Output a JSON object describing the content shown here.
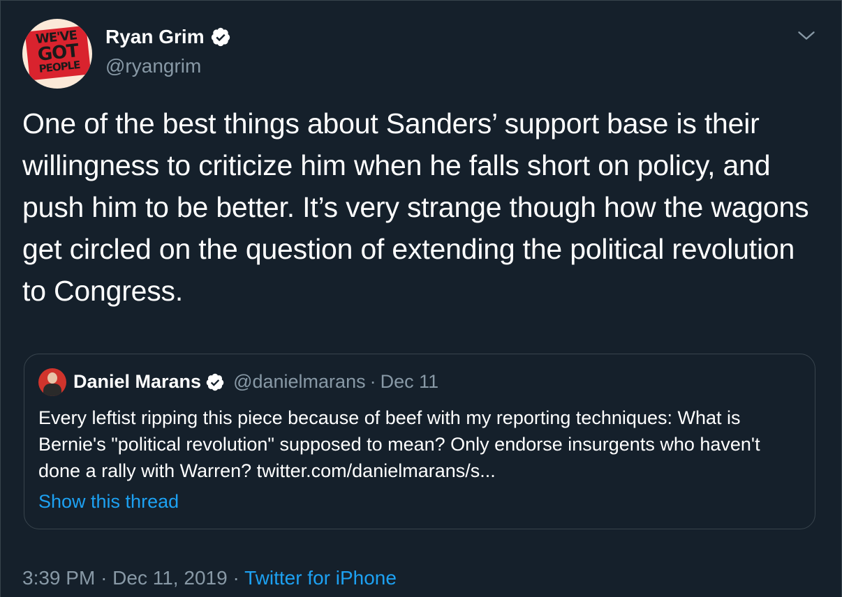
{
  "author": {
    "display_name": "Ryan Grim",
    "handle": "@ryangrim",
    "verified": true,
    "avatar_text": [
      "WE'VE",
      "GOT",
      "PEOPLE"
    ]
  },
  "tweet": {
    "text": "One of the best things about Sanders’ support base is their willingness to criticize him when he falls short on policy, and push him to be better. It’s very strange though how the wagons get circled on the question of extending the political revolution to Congress."
  },
  "quoted_tweet": {
    "display_name": "Daniel Marans",
    "handle": "@danielmarans",
    "separator": "·",
    "date": "Dec 11",
    "verified": true,
    "text": "Every leftist ripping this piece because of beef with my reporting techniques: What is Bernie's \"political revolution\" supposed to mean? Only endorse insurgents who haven't done a rally with Warren? twitter.com/danielmarans/s...",
    "show_thread_label": "Show this thread"
  },
  "meta": {
    "time": "3:39 PM",
    "separator": "·",
    "date": "Dec 11, 2019",
    "source": "Twitter for iPhone"
  },
  "colors": {
    "background": "#15202b",
    "border": "#38444d",
    "secondary_text": "#8899a6",
    "link": "#1da1f2",
    "verified_badge": "#ffffff"
  },
  "icons": {
    "verified": "verified-badge-icon",
    "menu": "chevron-down-icon"
  }
}
